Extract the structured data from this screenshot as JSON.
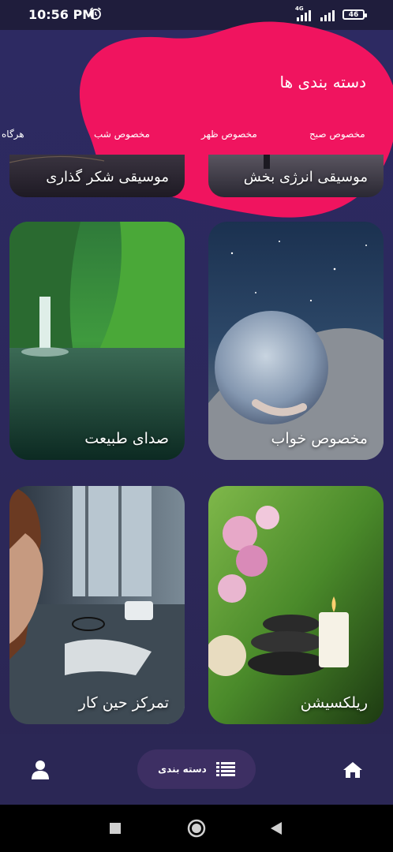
{
  "status_bar": {
    "time": "10:56 PM",
    "network": "4G",
    "battery": "46"
  },
  "header": {
    "title": "دسته بندی ها"
  },
  "chips": [
    {
      "label": "مخصوص صبح"
    },
    {
      "label": "مخصوص ظهر"
    },
    {
      "label": "مخصوص شب"
    },
    {
      "label": "هرگاه"
    }
  ],
  "cards": {
    "energy": "موسیقی انرژی بخش",
    "gratitude": "موسیقی شکر گذاری",
    "sleep": "مخصوص خواب",
    "nature": "صدای طبیعت",
    "relax": "ریلکسیشن",
    "focus": "تمرکز حین کار"
  },
  "bottom_nav": {
    "categories_label": "دسته بندی"
  },
  "colors": {
    "background": "#2d2a63",
    "blob": "#f0145f",
    "nav_pill": "#3d2f63"
  }
}
